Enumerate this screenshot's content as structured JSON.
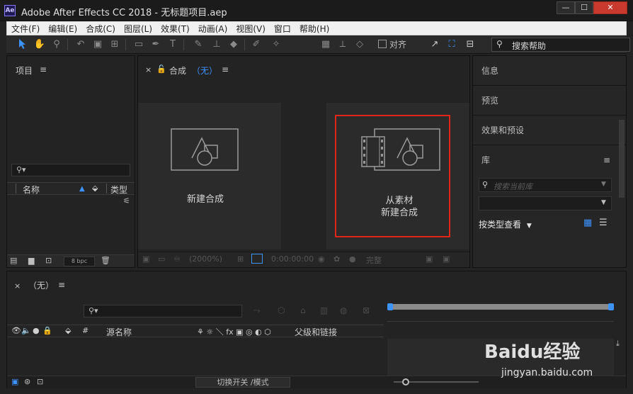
{
  "window": {
    "app_icon": "Ae",
    "title": "Adobe After Effects CC 2018 - 无标题项目.aep",
    "minimize": "—",
    "maximize": "☐",
    "close": "✕"
  },
  "menu": [
    "文件(F)",
    "编辑(E)",
    "合成(C)",
    "图层(L)",
    "效果(T)",
    "动画(A)",
    "视图(V)",
    "窗口",
    "帮助(H)"
  ],
  "toolbar": {
    "tools": [
      "selection-tool",
      "hand-tool",
      "zoom-tool",
      "rotate-tool",
      "camera-tool",
      "pan-behind-tool",
      "rectangle-tool",
      "pen-tool",
      "text-tool",
      "brush-tool",
      "clone-stamp-tool",
      "eraser-tool",
      "roto-brush-tool",
      "puppet-tool"
    ],
    "snap_label": "对齐",
    "help_placeholder": "搜索帮助"
  },
  "project": {
    "title": "项目",
    "col_name": "名称",
    "col_type": "类型",
    "bpc": "8 bpc"
  },
  "composition": {
    "tab_title": "合成",
    "tab_value": "（无）",
    "new_comp_label": "新建合成",
    "from_footage_line1": "从素材",
    "from_footage_line2": "新建合成",
    "zoom": "(2000%)",
    "timecode": "0:00:00:00",
    "quality": "完整"
  },
  "right_panels": {
    "info": "信息",
    "preview": "预览",
    "effects": "效果和预设",
    "library": "库",
    "library_search_placeholder": "搜索当前库",
    "view_by_type": "按类型查看"
  },
  "timeline": {
    "tab_title": "（无）",
    "col_source_name": "源名称",
    "col_parent": "父级和链接",
    "col_hash": "#",
    "switch_modes": "切换开关 /模式"
  },
  "watermark": {
    "brand": "Baidu经验",
    "url": "jingyan.baidu.com"
  },
  "colors": {
    "accent_blue": "#3d93ff",
    "highlight_red": "#e0251a",
    "close_red": "#c9392e"
  }
}
